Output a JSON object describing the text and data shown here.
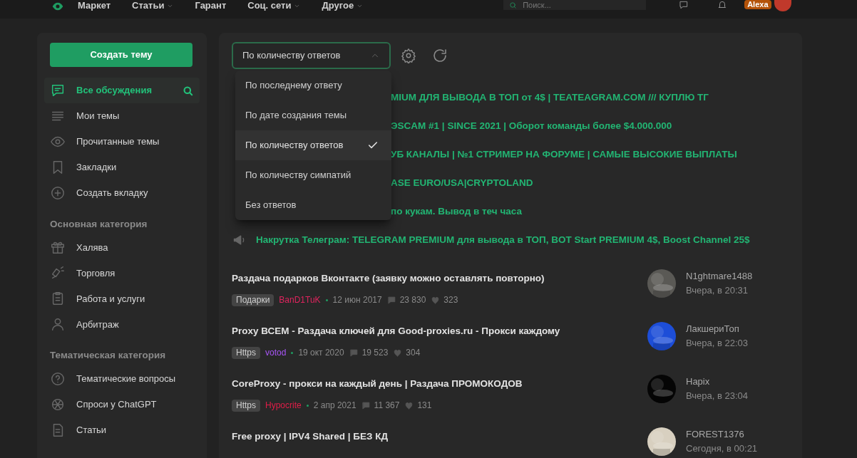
{
  "header": {
    "nav": [
      {
        "label": "Маркет",
        "caret": false
      },
      {
        "label": "Статьи",
        "caret": true
      },
      {
        "label": "Гарант",
        "caret": false
      },
      {
        "label": "Соц. сети",
        "caret": true
      },
      {
        "label": "Другое",
        "caret": true
      }
    ],
    "search": {
      "placeholder": "Поиск..."
    },
    "user_badge": "Alexa"
  },
  "sidebar": {
    "create_button": "Создать тему",
    "items": [
      {
        "label": "Все обсуждения",
        "selected": true
      },
      {
        "label": "Мои темы",
        "selected": false
      },
      {
        "label": "Прочитанные темы",
        "selected": false
      },
      {
        "label": "Закладки",
        "selected": false
      },
      {
        "label": "Создать вкладку",
        "selected": false
      }
    ],
    "sections": [
      {
        "title": "Основная категория",
        "items": [
          {
            "label": "Халява"
          },
          {
            "label": "Торговля"
          },
          {
            "label": "Работа и услуги"
          },
          {
            "label": "Арбитраж"
          }
        ]
      },
      {
        "title": "Тематическая категория",
        "items": [
          {
            "label": "Тематические вопросы"
          },
          {
            "label": "Спроси у ChatGPT"
          },
          {
            "label": "Статьи"
          }
        ]
      }
    ]
  },
  "sort": {
    "value": "По количеству ответов",
    "expanded": true,
    "options": [
      {
        "label": "По последнему ответу",
        "selected": false
      },
      {
        "label": "По дате создания темы",
        "selected": false
      },
      {
        "label": "По количеству ответов",
        "selected": true
      },
      {
        "label": "По количеству симпатий",
        "selected": false
      },
      {
        "label": "Без ответов",
        "selected": false
      }
    ]
  },
  "pinned": [
    {
      "kind": "partial",
      "text": "MIUM ДЛЯ ВЫВОДА В ТОП от 4$ | TEATEAGRAM.COM /// КУПЛЮ ТГ"
    },
    {
      "kind": "partial",
      "text": "ЭSCAM #1 | SINCE 2021 | Оборот команды более $4.000.000"
    },
    {
      "kind": "partial",
      "text": "УБ КАНАЛЫ | №1 СТРИМЕР НА ФОРУМЕ | САМЫЕ ВЫСОКИЕ ВЫПЛАТЫ"
    },
    {
      "kind": "partial",
      "text": "ASE EURO/USA|CRYPTOLAND"
    },
    {
      "kind": "partial",
      "text": "по кукам. Вывод в теч часа"
    },
    {
      "kind": "full",
      "text": "Накрутка Телеграм: TELEGRAM PREMIUM для вывода в ТОП, BOT Start PREMIUM 4$, Boost Channel 25$"
    }
  ],
  "threads": [
    {
      "title": "Раздача подарков Вконтакте (заявку можно оставлять повторно)",
      "tag": "Подарки",
      "author": "BanD1TuK",
      "color": "#e0245e",
      "date": "12 июн 2017",
      "replies": "23 830",
      "likes": "323",
      "last_user": "N1ghtmare1488",
      "last_time": "Вчера, в 20:31"
    },
    {
      "title": "Proxy ВСЕМ - Раздача ключей для Good-proxies.ru - Прокси каждому",
      "tag": "Https",
      "author": "votod",
      "color": "#a855f7",
      "date": "19 окт 2020",
      "replies": "19 523",
      "likes": "304",
      "last_user": "ЛакшериТоп",
      "last_time": "Вчера, в 22:03"
    },
    {
      "title": "CoreProxy - прокси на каждый день | Раздача ПРОМОКОДОВ",
      "tag": "Https",
      "author": "Hypocrite",
      "color": "#e11d48",
      "date": "2 апр 2021",
      "replies": "11 367",
      "likes": "131",
      "last_user": "Hapix",
      "last_time": "Вчера, в 23:04"
    },
    {
      "title": "Free proxy | IPV4 Shared | БЕЗ КД",
      "last_user": "FOREST1376",
      "last_time": "Сегодня, в 00:21"
    }
  ]
}
